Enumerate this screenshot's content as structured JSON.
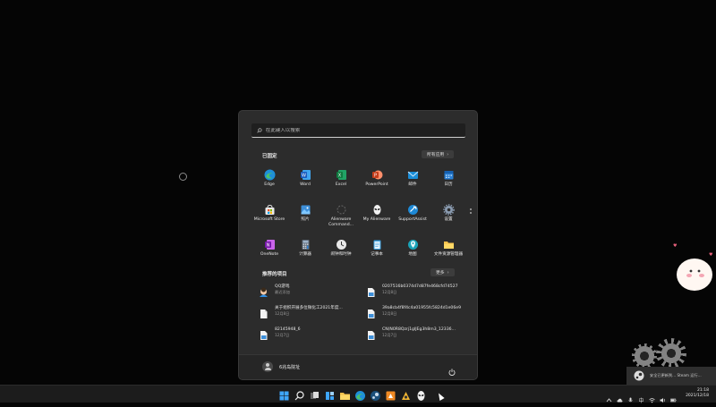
{
  "search": {
    "placeholder": "在此键入以搜索"
  },
  "pinned": {
    "title": "已固定",
    "all_apps_label": "所有应用",
    "apps": [
      {
        "label": "Edge",
        "icon": "edge-icon"
      },
      {
        "label": "Word",
        "icon": "word-icon"
      },
      {
        "label": "Excel",
        "icon": "excel-icon"
      },
      {
        "label": "PowerPoint",
        "icon": "powerpoint-icon"
      },
      {
        "label": "邮件",
        "icon": "mail-icon"
      },
      {
        "label": "日历",
        "icon": "calendar-icon"
      },
      {
        "label": "Microsoft Store",
        "icon": "store-icon"
      },
      {
        "label": "照片",
        "icon": "photos-icon"
      },
      {
        "label": "Alienware\nCommand...",
        "icon": "alienware-command-icon"
      },
      {
        "label": "My Alienware",
        "icon": "alienware-icon"
      },
      {
        "label": "SupportAssist",
        "icon": "supportassist-icon"
      },
      {
        "label": "设置",
        "icon": "settings-icon"
      },
      {
        "label": "OneNote",
        "icon": "onenote-icon"
      },
      {
        "label": "计算器",
        "icon": "calculator-icon"
      },
      {
        "label": "闹钟和时钟",
        "icon": "clock-icon"
      },
      {
        "label": "记事本",
        "icon": "notepad-icon"
      },
      {
        "label": "地图",
        "icon": "maps-icon"
      },
      {
        "label": "文件资源管理器",
        "icon": "file-explorer-icon"
      }
    ]
  },
  "recommended": {
    "title": "推荐的项目",
    "more_label": "更多",
    "items": [
      {
        "name": "QQ游戏",
        "sub": "最近添加",
        "icon": "qqgame-icon"
      },
      {
        "name": "0207516b0374d7d87fe468cfd74527",
        "sub": "12月8日",
        "icon": "image-file-icon"
      },
      {
        "name": "关于组织开展多位微化工2021年度...",
        "sub": "12月8日",
        "icon": "document-icon"
      },
      {
        "name": "39a8cb4f8f4c4a01955fc5824d1e06e9",
        "sub": "12月8日",
        "icon": "image-file-icon"
      },
      {
        "name": "82145948_6",
        "sub": "12月7日",
        "icon": "image-file-icon"
      },
      {
        "name": "CN(N0R8Qzrj1gIJEg3h8m3_12336...",
        "sub": "12月7日",
        "icon": "image-file-icon"
      }
    ]
  },
  "user": {
    "name": "6兆岛院址"
  },
  "taskbar": {
    "icons": [
      "windows-start-icon",
      "search-icon",
      "task-view-icon",
      "widgets-icon",
      "file-explorer-icon",
      "edge-icon",
      "steam-icon",
      "wallpaper-icon",
      "app-icon",
      "alienware-icon"
    ],
    "time": "21:18",
    "date": "2021/12/18"
  },
  "notification": {
    "text": "安全已更新到... Steam 运行..."
  },
  "colors": {
    "accent": "#0078d4",
    "menu_bg": "#2c2c2c",
    "taskbar_bg": "#1c1c1c"
  }
}
